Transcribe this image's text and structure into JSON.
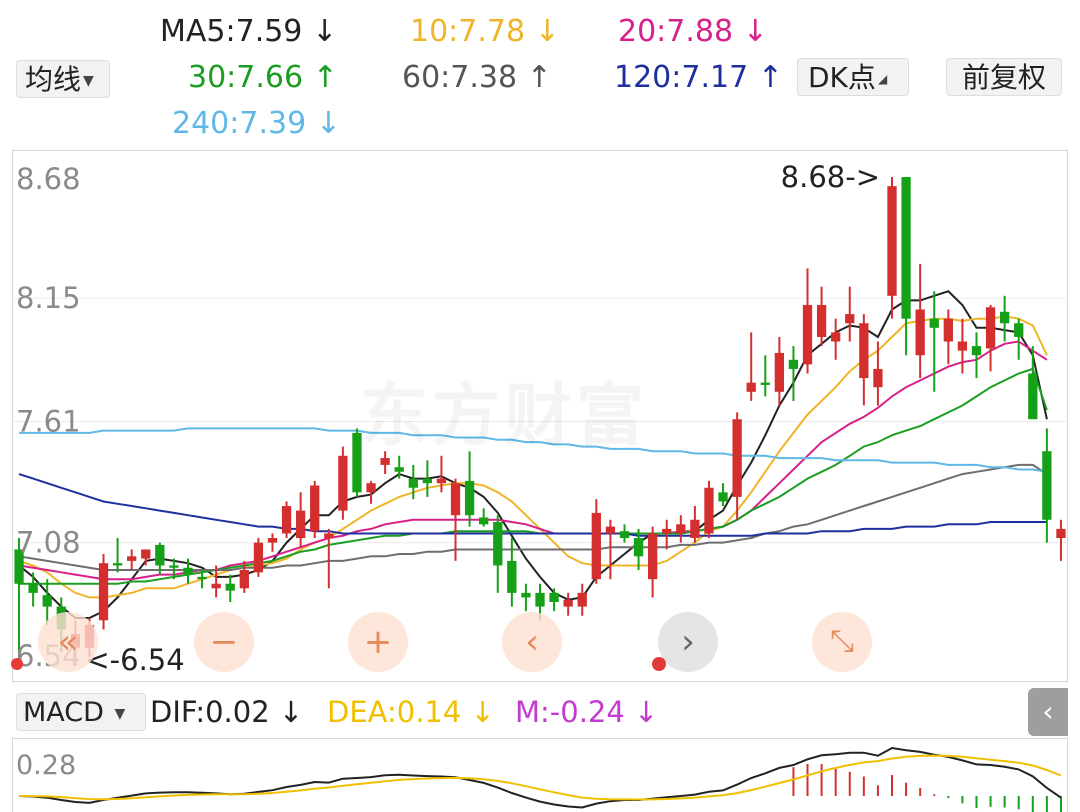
{
  "header": {
    "ma_button": "均线",
    "dk_button": "DK点",
    "adjust_button": "前复权",
    "ma_items": [
      {
        "label": "MA5:7.59",
        "arrow": "↓",
        "color": "#222222"
      },
      {
        "label": "10:7.78",
        "arrow": "↓",
        "color": "#f0b429"
      },
      {
        "label": "20:7.88",
        "arrow": "↓",
        "color": "#d6218a"
      },
      {
        "label": "30:7.66",
        "arrow": "↑",
        "color": "#1a9e22"
      },
      {
        "label": "60:7.38",
        "arrow": "↑",
        "color": "#555555"
      },
      {
        "label": "120:7.17",
        "arrow": "↑",
        "color": "#1f2f9e"
      },
      {
        "label": "240:7.39",
        "arrow": "↓",
        "color": "#5fb8e6"
      }
    ]
  },
  "chart_data": {
    "type": "candlestick",
    "y_ticks": [
      "8.68",
      "8.15",
      "7.61",
      "7.08",
      "6.54"
    ],
    "ylim": [
      6.54,
      8.68
    ],
    "high_marker": "8.68->",
    "low_marker": "<-6.54",
    "watermark": "东方财富",
    "up_color": "#d32f2f",
    "down_color": "#16a018",
    "candles": [
      {
        "o": 7.05,
        "h": 7.1,
        "l": 6.55,
        "c": 6.9
      },
      {
        "o": 6.9,
        "h": 6.95,
        "l": 6.8,
        "c": 6.86
      },
      {
        "o": 6.85,
        "h": 6.92,
        "l": 6.72,
        "c": 6.8
      },
      {
        "o": 6.8,
        "h": 6.84,
        "l": 6.6,
        "c": 6.7
      },
      {
        "o": 6.62,
        "h": 6.74,
        "l": 6.54,
        "c": 6.68
      },
      {
        "o": 6.62,
        "h": 6.75,
        "l": 6.58,
        "c": 6.72
      },
      {
        "o": 6.74,
        "h": 7.03,
        "l": 6.7,
        "c": 6.99
      },
      {
        "o": 6.99,
        "h": 7.1,
        "l": 6.95,
        "c": 6.98
      },
      {
        "o": 7.0,
        "h": 7.05,
        "l": 6.96,
        "c": 7.02
      },
      {
        "o": 7.01,
        "h": 7.05,
        "l": 6.98,
        "c": 7.05
      },
      {
        "o": 7.07,
        "h": 7.08,
        "l": 6.94,
        "c": 6.98
      },
      {
        "o": 6.98,
        "h": 7.01,
        "l": 6.92,
        "c": 6.97
      },
      {
        "o": 6.97,
        "h": 7.01,
        "l": 6.9,
        "c": 6.94
      },
      {
        "o": 6.93,
        "h": 6.96,
        "l": 6.88,
        "c": 6.92
      },
      {
        "o": 6.88,
        "h": 6.98,
        "l": 6.84,
        "c": 6.9
      },
      {
        "o": 6.9,
        "h": 6.94,
        "l": 6.82,
        "c": 6.87
      },
      {
        "o": 6.88,
        "h": 7.0,
        "l": 6.86,
        "c": 6.96
      },
      {
        "o": 6.95,
        "h": 7.1,
        "l": 6.93,
        "c": 7.08
      },
      {
        "o": 7.08,
        "h": 7.12,
        "l": 7.04,
        "c": 7.1
      },
      {
        "o": 7.12,
        "h": 7.26,
        "l": 7.1,
        "c": 7.24
      },
      {
        "o": 7.1,
        "h": 7.3,
        "l": 7.06,
        "c": 7.22
      },
      {
        "o": 7.13,
        "h": 7.35,
        "l": 7.1,
        "c": 7.33
      },
      {
        "o": 7.1,
        "h": 7.14,
        "l": 6.88,
        "c": 7.12
      },
      {
        "o": 7.22,
        "h": 7.5,
        "l": 7.18,
        "c": 7.46
      },
      {
        "o": 7.56,
        "h": 7.58,
        "l": 7.28,
        "c": 7.3
      },
      {
        "o": 7.3,
        "h": 7.35,
        "l": 7.25,
        "c": 7.34
      },
      {
        "o": 7.42,
        "h": 7.48,
        "l": 7.38,
        "c": 7.45
      },
      {
        "o": 7.41,
        "h": 7.46,
        "l": 7.36,
        "c": 7.39
      },
      {
        "o": 7.36,
        "h": 7.42,
        "l": 7.27,
        "c": 7.32
      },
      {
        "o": 7.36,
        "h": 7.44,
        "l": 7.28,
        "c": 7.34
      },
      {
        "o": 7.34,
        "h": 7.46,
        "l": 7.3,
        "c": 7.36
      },
      {
        "o": 7.2,
        "h": 7.36,
        "l": 7.0,
        "c": 7.34
      },
      {
        "o": 7.35,
        "h": 7.48,
        "l": 7.15,
        "c": 7.2
      },
      {
        "o": 7.19,
        "h": 7.23,
        "l": 7.15,
        "c": 7.16
      },
      {
        "o": 7.17,
        "h": 7.2,
        "l": 6.86,
        "c": 6.98
      },
      {
        "o": 7.0,
        "h": 7.1,
        "l": 6.8,
        "c": 6.86
      },
      {
        "o": 6.86,
        "h": 6.9,
        "l": 6.78,
        "c": 6.84
      },
      {
        "o": 6.86,
        "h": 6.9,
        "l": 6.74,
        "c": 6.8
      },
      {
        "o": 6.86,
        "h": 6.88,
        "l": 6.78,
        "c": 6.82
      },
      {
        "o": 6.8,
        "h": 6.86,
        "l": 6.76,
        "c": 6.83
      },
      {
        "o": 6.8,
        "h": 6.9,
        "l": 6.76,
        "c": 6.86
      },
      {
        "o": 6.92,
        "h": 7.27,
        "l": 6.9,
        "c": 7.21
      },
      {
        "o": 7.12,
        "h": 7.18,
        "l": 6.92,
        "c": 7.15
      },
      {
        "o": 7.13,
        "h": 7.16,
        "l": 7.08,
        "c": 7.1
      },
      {
        "o": 7.1,
        "h": 7.14,
        "l": 6.96,
        "c": 7.02
      },
      {
        "o": 6.92,
        "h": 7.15,
        "l": 6.84,
        "c": 7.12
      },
      {
        "o": 7.12,
        "h": 7.18,
        "l": 7.05,
        "c": 7.14
      },
      {
        "o": 7.12,
        "h": 7.2,
        "l": 7.08,
        "c": 7.16
      },
      {
        "o": 7.1,
        "h": 7.24,
        "l": 7.08,
        "c": 7.18
      },
      {
        "o": 7.12,
        "h": 7.35,
        "l": 7.1,
        "c": 7.32
      },
      {
        "o": 7.3,
        "h": 7.34,
        "l": 7.24,
        "c": 7.26
      },
      {
        "o": 7.28,
        "h": 7.65,
        "l": 7.18,
        "c": 7.62
      },
      {
        "o": 7.74,
        "h": 8.0,
        "l": 7.7,
        "c": 7.78
      },
      {
        "o": 7.78,
        "h": 7.9,
        "l": 7.72,
        "c": 7.77
      },
      {
        "o": 7.74,
        "h": 7.98,
        "l": 7.68,
        "c": 7.91
      },
      {
        "o": 7.88,
        "h": 7.94,
        "l": 7.7,
        "c": 7.84
      },
      {
        "o": 7.86,
        "h": 8.28,
        "l": 7.82,
        "c": 8.12
      },
      {
        "o": 7.98,
        "h": 8.2,
        "l": 7.94,
        "c": 8.12
      },
      {
        "o": 7.96,
        "h": 8.06,
        "l": 7.88,
        "c": 8.0
      },
      {
        "o": 8.04,
        "h": 8.2,
        "l": 7.96,
        "c": 8.08
      },
      {
        "o": 7.8,
        "h": 8.08,
        "l": 7.68,
        "c": 8.04
      },
      {
        "o": 7.76,
        "h": 7.96,
        "l": 7.68,
        "c": 7.84
      },
      {
        "o": 8.16,
        "h": 8.68,
        "l": 8.06,
        "c": 8.64
      },
      {
        "o": 8.68,
        "h": 8.68,
        "l": 7.9,
        "c": 8.06
      },
      {
        "o": 7.9,
        "h": 8.3,
        "l": 7.8,
        "c": 8.1
      },
      {
        "o": 8.06,
        "h": 8.18,
        "l": 7.74,
        "c": 8.02
      },
      {
        "o": 7.96,
        "h": 8.1,
        "l": 7.86,
        "c": 8.06
      },
      {
        "o": 7.92,
        "h": 8.06,
        "l": 7.82,
        "c": 7.96
      },
      {
        "o": 7.94,
        "h": 8.0,
        "l": 7.8,
        "c": 7.9
      },
      {
        "o": 7.93,
        "h": 8.12,
        "l": 7.83,
        "c": 8.11
      },
      {
        "o": 8.09,
        "h": 8.16,
        "l": 7.96,
        "c": 8.04
      },
      {
        "o": 8.04,
        "h": 8.06,
        "l": 7.88,
        "c": 7.98
      },
      {
        "o": 7.82,
        "h": 7.94,
        "l": 7.78,
        "c": 7.62
      },
      {
        "o": 7.48,
        "h": 7.58,
        "l": 7.08,
        "c": 7.18
      },
      {
        "o": 7.1,
        "h": 7.18,
        "l": 7.0,
        "c": 7.14
      }
    ],
    "ma_lines": [
      {
        "name": "MA5",
        "color": "#222222",
        "values": [
          6.98,
          6.93,
          6.86,
          6.8,
          6.75,
          6.75,
          6.78,
          6.84,
          6.92,
          7.0,
          7.01,
          7.0,
          6.99,
          6.97,
          6.93,
          6.93,
          6.94,
          6.96,
          7.0,
          7.08,
          7.14,
          7.2,
          7.2,
          7.26,
          7.28,
          7.29,
          7.34,
          7.38,
          7.36,
          7.36,
          7.37,
          7.34,
          7.32,
          7.28,
          7.21,
          7.11,
          7.01,
          6.93,
          6.86,
          6.83,
          6.84,
          6.93,
          6.98,
          7.03,
          7.08,
          7.12,
          7.12,
          7.12,
          7.13,
          7.18,
          7.22,
          7.33,
          7.43,
          7.55,
          7.68,
          7.78,
          7.9,
          7.95,
          8.0,
          8.03,
          8.02,
          7.98,
          8.1,
          8.14,
          8.14,
          8.16,
          8.18,
          8.12,
          8.02,
          8.02,
          8.01,
          8.0,
          7.9,
          7.62
        ]
      },
      {
        "name": "MA10",
        "color": "#f0b429",
        "values": [
          7.0,
          6.98,
          6.95,
          6.9,
          6.86,
          6.84,
          6.84,
          6.85,
          6.86,
          6.88,
          6.88,
          6.88,
          6.9,
          6.92,
          6.94,
          6.96,
          6.97,
          6.98,
          6.99,
          7.01,
          7.05,
          7.08,
          7.1,
          7.14,
          7.18,
          7.22,
          7.25,
          7.28,
          7.3,
          7.32,
          7.33,
          7.34,
          7.34,
          7.33,
          7.3,
          7.26,
          7.2,
          7.14,
          7.08,
          7.02,
          6.99,
          6.98,
          6.98,
          6.98,
          6.98,
          6.98,
          7.0,
          7.04,
          7.08,
          7.13,
          7.15,
          7.22,
          7.3,
          7.39,
          7.48,
          7.56,
          7.64,
          7.7,
          7.76,
          7.83,
          7.88,
          7.92,
          7.98,
          8.04,
          8.05,
          8.06,
          8.06,
          8.05,
          8.06,
          8.06,
          8.07,
          8.06,
          8.03,
          7.9
        ]
      },
      {
        "name": "MA20",
        "color": "#d6218a",
        "values": [
          6.98,
          6.97,
          6.96,
          6.95,
          6.94,
          6.93,
          6.92,
          6.92,
          6.92,
          6.93,
          6.94,
          6.94,
          6.95,
          6.96,
          6.96,
          6.98,
          6.99,
          7.0,
          7.02,
          7.04,
          7.06,
          7.08,
          7.1,
          7.11,
          7.13,
          7.14,
          7.16,
          7.17,
          7.18,
          7.18,
          7.18,
          7.18,
          7.18,
          7.18,
          7.18,
          7.17,
          7.16,
          7.14,
          7.12,
          7.12,
          7.12,
          7.12,
          7.12,
          7.12,
          7.12,
          7.12,
          7.12,
          7.13,
          7.13,
          7.14,
          7.15,
          7.18,
          7.22,
          7.28,
          7.34,
          7.4,
          7.46,
          7.52,
          7.56,
          7.6,
          7.63,
          7.67,
          7.72,
          7.76,
          7.79,
          7.82,
          7.85,
          7.87,
          7.88,
          7.92,
          7.95,
          7.96,
          7.92,
          7.88
        ]
      },
      {
        "name": "MA30",
        "color": "#1a9e22",
        "values": [
          6.9,
          6.9,
          6.9,
          6.9,
          6.9,
          6.9,
          6.9,
          6.9,
          6.91,
          6.91,
          6.92,
          6.93,
          6.94,
          6.95,
          6.96,
          6.97,
          6.98,
          6.99,
          7.0,
          7.02,
          7.04,
          7.05,
          7.07,
          7.08,
          7.09,
          7.1,
          7.11,
          7.11,
          7.12,
          7.12,
          7.12,
          7.13,
          7.13,
          7.13,
          7.13,
          7.13,
          7.13,
          7.12,
          7.12,
          7.12,
          7.12,
          7.12,
          7.12,
          7.12,
          7.12,
          7.12,
          7.12,
          7.12,
          7.13,
          7.14,
          7.15,
          7.18,
          7.22,
          7.25,
          7.28,
          7.32,
          7.36,
          7.39,
          7.42,
          7.46,
          7.5,
          7.52,
          7.55,
          7.57,
          7.59,
          7.62,
          7.65,
          7.68,
          7.72,
          7.76,
          7.79,
          7.82,
          7.84,
          7.66
        ]
      },
      {
        "name": "MA60",
        "color": "#6e6e6e",
        "values": [
          7.02,
          7.01,
          7.0,
          6.99,
          6.98,
          6.97,
          6.96,
          6.96,
          6.96,
          6.96,
          6.96,
          6.96,
          6.96,
          6.96,
          6.96,
          6.96,
          6.97,
          6.97,
          6.97,
          6.98,
          6.98,
          6.99,
          7.0,
          7.0,
          7.01,
          7.02,
          7.02,
          7.03,
          7.03,
          7.04,
          7.04,
          7.05,
          7.05,
          7.05,
          7.05,
          7.05,
          7.05,
          7.05,
          7.05,
          7.05,
          7.05,
          7.05,
          7.06,
          7.06,
          7.06,
          7.06,
          7.06,
          7.07,
          7.07,
          7.08,
          7.08,
          7.09,
          7.1,
          7.12,
          7.13,
          7.15,
          7.16,
          7.18,
          7.2,
          7.22,
          7.24,
          7.26,
          7.28,
          7.3,
          7.32,
          7.34,
          7.36,
          7.38,
          7.39,
          7.4,
          7.41,
          7.42,
          7.42,
          7.38
        ]
      },
      {
        "name": "MA120",
        "color": "#1f2f9e",
        "values": [
          7.38,
          7.36,
          7.34,
          7.32,
          7.3,
          7.28,
          7.26,
          7.25,
          7.24,
          7.23,
          7.22,
          7.21,
          7.2,
          7.19,
          7.18,
          7.17,
          7.16,
          7.15,
          7.15,
          7.14,
          7.14,
          7.13,
          7.13,
          7.12,
          7.12,
          7.12,
          7.12,
          7.12,
          7.12,
          7.12,
          7.12,
          7.12,
          7.12,
          7.12,
          7.12,
          7.12,
          7.12,
          7.12,
          7.12,
          7.12,
          7.12,
          7.12,
          7.12,
          7.12,
          7.11,
          7.11,
          7.11,
          7.11,
          7.11,
          7.11,
          7.11,
          7.11,
          7.11,
          7.12,
          7.12,
          7.12,
          7.12,
          7.13,
          7.13,
          7.13,
          7.14,
          7.14,
          7.14,
          7.15,
          7.15,
          7.15,
          7.16,
          7.16,
          7.16,
          7.17,
          7.17,
          7.17,
          7.17,
          7.17
        ]
      },
      {
        "name": "MA240",
        "color": "#5fb8e6",
        "values": [
          7.56,
          7.56,
          7.56,
          7.56,
          7.56,
          7.56,
          7.57,
          7.57,
          7.57,
          7.57,
          7.57,
          7.57,
          7.58,
          7.58,
          7.58,
          7.58,
          7.58,
          7.58,
          7.58,
          7.58,
          7.58,
          7.58,
          7.57,
          7.57,
          7.57,
          7.56,
          7.56,
          7.56,
          7.55,
          7.55,
          7.55,
          7.54,
          7.54,
          7.54,
          7.53,
          7.53,
          7.52,
          7.52,
          7.51,
          7.51,
          7.5,
          7.5,
          7.49,
          7.49,
          7.49,
          7.48,
          7.48,
          7.48,
          7.47,
          7.47,
          7.47,
          7.46,
          7.46,
          7.46,
          7.45,
          7.45,
          7.45,
          7.45,
          7.44,
          7.44,
          7.44,
          7.44,
          7.43,
          7.43,
          7.43,
          7.43,
          7.42,
          7.42,
          7.42,
          7.41,
          7.41,
          7.4,
          7.4,
          7.39
        ]
      }
    ],
    "macd": {
      "legend_button": "MACD",
      "y_tick": "0.28",
      "items": [
        {
          "label": "DIF:0.02",
          "arrow": "↓",
          "color": "#222222"
        },
        {
          "label": "DEA:0.14",
          "arrow": "↓",
          "color": "#f0c000"
        },
        {
          "label": "M:-0.24",
          "arrow": "↓",
          "color": "#c43bd0"
        }
      ]
    }
  },
  "nav_buttons": {
    "rewind": "«",
    "zoom_out": "−",
    "zoom_in": "+",
    "prev": "‹",
    "next": "›",
    "expand": "⤡"
  },
  "side_tab": "‹"
}
